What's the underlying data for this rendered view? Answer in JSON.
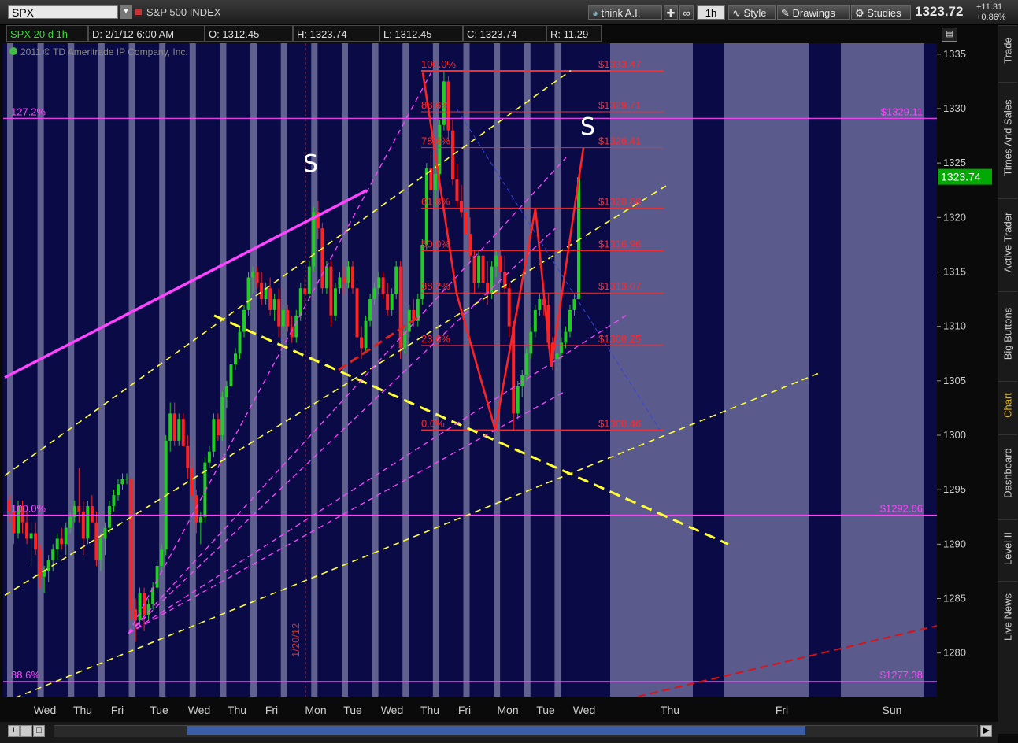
{
  "toolbar": {
    "symbol": "SPX",
    "index_name": "S&P 500 INDEX",
    "think_ai": "think A.I.",
    "timeframe": "1h",
    "style": "Style",
    "drawings": "Drawings",
    "studies": "Studies",
    "last_price": "1323.72",
    "change_abs": "+11.31",
    "change_pct": "+0.86%"
  },
  "infobar": {
    "chart_desc": "SPX 20 d 1h",
    "date": "D: 2/1/12 6:00 AM",
    "open": "O: 1312.45",
    "high": "H: 1323.74",
    "low": "L: 1312.45",
    "close": "C: 1323.74",
    "range": "R: 11.29"
  },
  "copyright": "2011 © TD Ameritrade IP Company, Inc.",
  "side_tabs": [
    "Trade",
    "Times And Sales",
    "Active Trader",
    "Big Buttons",
    "Chart",
    "Dashboard",
    "Level II",
    "Live News"
  ],
  "active_tab": "Chart",
  "colors": {
    "background": "#0a0a46",
    "session_band": "#6a6a98",
    "future_band": "#5a5a8c",
    "up": "#22cc22",
    "down": "#ff2222",
    "fib": "#ff2a2a",
    "magenta": "#ff44ff",
    "yellow": "#ffff33",
    "price_tag": "#00aa00"
  },
  "chart_data": {
    "type": "candlestick",
    "symbol": "SPX",
    "ylim": [
      1276,
      1336
    ],
    "yticks": [
      1280,
      1285,
      1290,
      1295,
      1300,
      1305,
      1310,
      1315,
      1320,
      1325,
      1330,
      1335
    ],
    "x_labels": [
      "Wed",
      "Thu",
      "Fri",
      "Tue",
      "Wed",
      "Thu",
      "Fri",
      "Mon",
      "Tue",
      "Wed",
      "Thu",
      "Fri",
      "Mon",
      "Tue",
      "Wed",
      "Thu",
      "Fri",
      "Sun"
    ],
    "vertical_date_label": "1/20/12",
    "current_price": "1323.74",
    "fib_retracement": [
      {
        "pct": "100.0%",
        "price": "$1333.47",
        "value": 1333.47
      },
      {
        "pct": "88.6%",
        "price": "$1329.71",
        "value": 1329.71
      },
      {
        "pct": "78.6%",
        "price": "$1326.41",
        "value": 1326.41
      },
      {
        "pct": "61.8%",
        "price": "$1320.86",
        "value": 1320.86
      },
      {
        "pct": "50.0%",
        "price": "$1316.96",
        "value": 1316.96
      },
      {
        "pct": "38.2%",
        "price": "$1313.07",
        "value": 1313.07
      },
      {
        "pct": "23.6%",
        "price": "$1308.25",
        "value": 1308.25
      },
      {
        "pct": "0.0%",
        "price": "$1300.46",
        "value": 1300.46
      }
    ],
    "fib_extension": [
      {
        "pct": "127.2%",
        "price": "$1329.11",
        "value": 1329.11
      },
      {
        "pct": "100.0%",
        "price": "$1292.66",
        "value": 1292.66
      },
      {
        "pct": "88.6%",
        "price": "$1277.38",
        "value": 1277.38
      }
    ],
    "annotations": [
      "S",
      "S"
    ],
    "candles": [
      [
        1294,
        1294.5,
        1292,
        1293
      ],
      [
        1293,
        1293.5,
        1290,
        1291
      ],
      [
        1291,
        1294,
        1290.5,
        1293.5
      ],
      [
        1293.5,
        1294,
        1291,
        1292
      ],
      [
        1292,
        1293,
        1290,
        1290.5
      ],
      [
        1290.5,
        1292,
        1288,
        1291
      ],
      [
        1291,
        1292,
        1289,
        1289.5
      ],
      [
        1289.5,
        1290,
        1286,
        1287
      ],
      [
        1287,
        1288,
        1285.5,
        1287.5
      ],
      [
        1287.5,
        1289,
        1286.5,
        1288.5
      ],
      [
        1288.5,
        1290,
        1287.5,
        1289.5
      ],
      [
        1289.5,
        1291,
        1288.5,
        1290.5
      ],
      [
        1290.5,
        1291.5,
        1289.5,
        1290
      ],
      [
        1290,
        1292,
        1289,
        1291.5
      ],
      [
        1291.5,
        1293,
        1291,
        1292.5
      ],
      [
        1292.5,
        1294,
        1292,
        1293.5
      ],
      [
        1293.5,
        1297,
        1292,
        1293
      ],
      [
        1293,
        1294,
        1289,
        1290.5
      ],
      [
        1290.5,
        1294,
        1290,
        1293.5
      ],
      [
        1293.5,
        1294.5,
        1292,
        1292
      ],
      [
        1292,
        1293,
        1288,
        1288.5
      ],
      [
        1288.5,
        1291,
        1287.5,
        1290.5
      ],
      [
        1290.5,
        1292,
        1289,
        1291.5
      ],
      [
        1291.5,
        1294,
        1291,
        1293.5
      ],
      [
        1293.5,
        1295,
        1293,
        1294.5
      ],
      [
        1294.5,
        1296,
        1294,
        1295.5
      ],
      [
        1295.5,
        1296.5,
        1295,
        1296
      ],
      [
        1296,
        1296.5,
        1295.5,
        1296
      ],
      [
        1296,
        1296,
        1283,
        1284
      ],
      [
        1284,
        1285,
        1281,
        1283
      ],
      [
        1283,
        1286,
        1282.5,
        1285.5
      ],
      [
        1285.5,
        1286,
        1282,
        1283.5
      ],
      [
        1283.5,
        1285,
        1283,
        1284.5
      ],
      [
        1284.5,
        1286.5,
        1284,
        1286
      ],
      [
        1286,
        1288.5,
        1285.5,
        1288
      ],
      [
        1288,
        1290,
        1287.5,
        1289.5
      ],
      [
        1289.5,
        1300,
        1289,
        1299.5
      ],
      [
        1299.5,
        1303,
        1298.5,
        1302
      ],
      [
        1302,
        1303,
        1299,
        1299.5
      ],
      [
        1299.5,
        1302,
        1299,
        1301.5
      ],
      [
        1301.5,
        1302,
        1299,
        1299
      ],
      [
        1299,
        1300,
        1296,
        1297
      ],
      [
        1297,
        1298,
        1294,
        1294.5
      ],
      [
        1294.5,
        1295,
        1291,
        1292
      ],
      [
        1292,
        1293,
        1290,
        1292.5
      ],
      [
        1292.5,
        1298,
        1292,
        1297.5
      ],
      [
        1297.5,
        1299,
        1297,
        1298.5
      ],
      [
        1298.5,
        1302,
        1298,
        1301.5
      ],
      [
        1301.5,
        1302,
        1299.5,
        1300
      ],
      [
        1300,
        1304,
        1299.5,
        1303.5
      ],
      [
        1303.5,
        1305,
        1302.5,
        1304.5
      ],
      [
        1304.5,
        1307,
        1304,
        1306.5
      ],
      [
        1306.5,
        1308,
        1306,
        1307.5
      ],
      [
        1307.5,
        1310,
        1307,
        1309.5
      ],
      [
        1309.5,
        1312,
        1309,
        1311.5
      ],
      [
        1311.5,
        1315,
        1311,
        1314.5
      ],
      [
        1314.5,
        1315.5,
        1313,
        1315
      ],
      [
        1315,
        1315.5,
        1313.5,
        1314
      ],
      [
        1314,
        1315,
        1312,
        1312.5
      ],
      [
        1312.5,
        1314,
        1312,
        1313.5
      ],
      [
        1313.5,
        1314.5,
        1311,
        1311.5
      ],
      [
        1311.5,
        1313,
        1310.5,
        1312.5
      ],
      [
        1312.5,
        1313.5,
        1309,
        1310
      ],
      [
        1310,
        1312,
        1309.5,
        1311.5
      ],
      [
        1311.5,
        1312,
        1309.5,
        1310
      ],
      [
        1310,
        1311,
        1308.5,
        1309
      ],
      [
        1309,
        1311.5,
        1308.5,
        1311
      ],
      [
        1311,
        1314,
        1310.5,
        1313.5
      ],
      [
        1313.5,
        1314.5,
        1312,
        1313
      ],
      [
        1313,
        1316,
        1312.5,
        1315.5
      ],
      [
        1315.5,
        1321,
        1315,
        1320.5
      ],
      [
        1320.5,
        1321.5,
        1318,
        1319
      ],
      [
        1319,
        1319.5,
        1313,
        1313.5
      ],
      [
        1313.5,
        1316,
        1313,
        1315.5
      ],
      [
        1315.5,
        1316,
        1310,
        1311
      ],
      [
        1311,
        1314,
        1310.5,
        1313.5
      ],
      [
        1313.5,
        1315,
        1313,
        1314.5
      ],
      [
        1314.5,
        1315.5,
        1313,
        1314
      ],
      [
        1314,
        1316,
        1313.5,
        1315.5
      ],
      [
        1315.5,
        1316,
        1313,
        1313.5
      ],
      [
        1313.5,
        1314,
        1308,
        1309
      ],
      [
        1309,
        1310,
        1307,
        1308
      ],
      [
        1308,
        1311,
        1307.5,
        1310.5
      ],
      [
        1310.5,
        1313,
        1310,
        1312.5
      ],
      [
        1312.5,
        1314,
        1312,
        1313.5
      ],
      [
        1313.5,
        1315,
        1313,
        1314.5
      ],
      [
        1314.5,
        1315,
        1312.5,
        1313
      ],
      [
        1313,
        1314,
        1311,
        1311.5
      ],
      [
        1311.5,
        1313.5,
        1311,
        1313
      ],
      [
        1313,
        1316,
        1312.5,
        1315.5
      ],
      [
        1315.5,
        1316,
        1307,
        1308
      ],
      [
        1308,
        1310,
        1307.5,
        1309.5
      ],
      [
        1309.5,
        1312,
        1309,
        1311.5
      ],
      [
        1311.5,
        1312.5,
        1310,
        1310.5
      ],
      [
        1310.5,
        1313,
        1310,
        1312.5
      ],
      [
        1312.5,
        1318,
        1312,
        1317.5
      ],
      [
        1317.5,
        1325,
        1317,
        1324.5
      ],
      [
        1324.5,
        1326,
        1322,
        1322.5
      ],
      [
        1322.5,
        1325,
        1321,
        1324
      ],
      [
        1324,
        1329,
        1323.5,
        1328.5
      ],
      [
        1328.5,
        1333.5,
        1328,
        1332.5
      ],
      [
        1332.5,
        1333,
        1327,
        1328
      ],
      [
        1328,
        1329,
        1323,
        1323.5
      ],
      [
        1323.5,
        1325,
        1321,
        1321.5
      ],
      [
        1321.5,
        1323,
        1320,
        1320.5
      ],
      [
        1320.5,
        1321,
        1318,
        1318.5
      ],
      [
        1318.5,
        1320,
        1316,
        1316.5
      ],
      [
        1316.5,
        1317,
        1313,
        1314
      ],
      [
        1314,
        1317,
        1313.5,
        1316.5
      ],
      [
        1316.5,
        1317,
        1313.5,
        1314
      ],
      [
        1314,
        1316,
        1312,
        1313
      ],
      [
        1313,
        1316,
        1312.5,
        1315.5
      ],
      [
        1315.5,
        1317,
        1314.5,
        1316.5
      ],
      [
        1316.5,
        1317,
        1314,
        1315
      ],
      [
        1315,
        1316.5,
        1313,
        1313.5
      ],
      [
        1313.5,
        1314,
        1309,
        1310
      ],
      [
        1310,
        1310.5,
        1300.5,
        1302
      ],
      [
        1302,
        1305,
        1301.5,
        1304.5
      ],
      [
        1304.5,
        1306,
        1303.5,
        1305.5
      ],
      [
        1305.5,
        1308,
        1305,
        1307.5
      ],
      [
        1307.5,
        1310,
        1307,
        1309.5
      ],
      [
        1309.5,
        1312,
        1309,
        1311.5
      ],
      [
        1311.5,
        1313,
        1311,
        1312.5
      ],
      [
        1312.5,
        1313.5,
        1311,
        1312
      ],
      [
        1312,
        1313,
        1308,
        1308.5
      ],
      [
        1308.5,
        1309,
        1306,
        1307
      ],
      [
        1307,
        1308,
        1306,
        1307.5
      ],
      [
        1307.5,
        1309,
        1307,
        1308.5
      ],
      [
        1308.5,
        1310,
        1308,
        1309.5
      ],
      [
        1309.5,
        1312,
        1309,
        1311.5
      ],
      [
        1311.5,
        1313,
        1311,
        1312.5
      ],
      [
        1312.5,
        1324,
        1312.5,
        1323.7
      ]
    ]
  }
}
